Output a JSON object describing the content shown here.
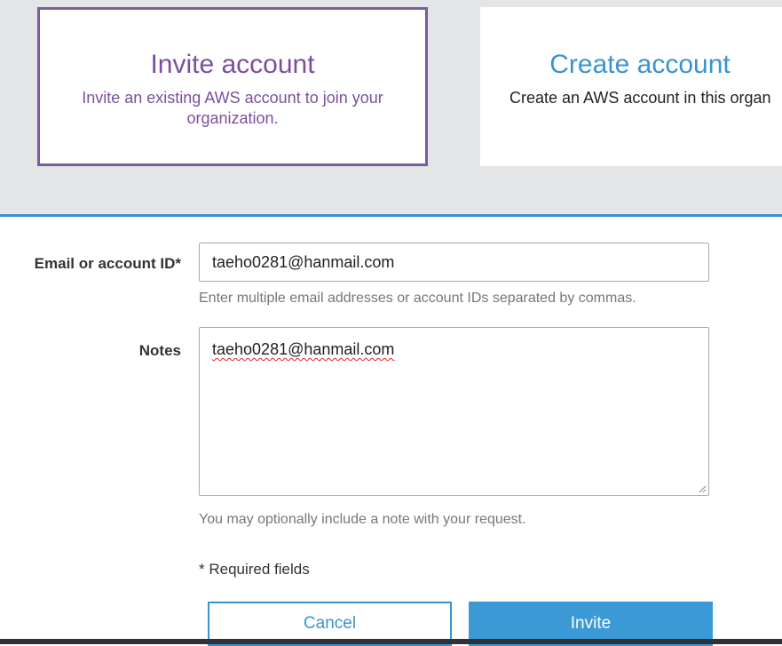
{
  "cards": {
    "invite": {
      "title": "Invite account",
      "description": "Invite an existing AWS account to join your organization."
    },
    "create": {
      "title": "Create account",
      "description": "Create an AWS account in this organ"
    }
  },
  "form": {
    "email": {
      "label": "Email or account ID*",
      "value": "taeho0281@hanmail.com",
      "hint": "Enter multiple email addresses or account IDs separated by commas."
    },
    "notes": {
      "label": "Notes",
      "value": "taeho0281@hanmail.com",
      "hint": "You may optionally include a note with your request."
    },
    "required_note": "* Required fields"
  },
  "buttons": {
    "cancel": "Cancel",
    "invite": "Invite"
  },
  "colors": {
    "invite_accent": "#7b4f9d",
    "create_accent": "#3b93cf",
    "primary_button": "#3b99d6",
    "band_background": "#e4e5e7"
  }
}
